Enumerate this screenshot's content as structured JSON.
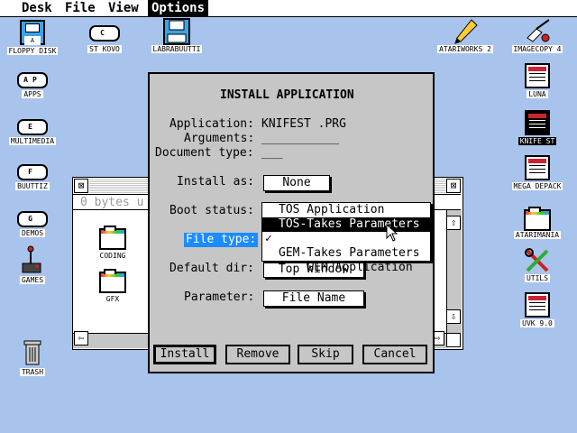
{
  "menubar": {
    "items": [
      {
        "label": "Desk"
      },
      {
        "label": "File"
      },
      {
        "label": "View"
      },
      {
        "label": "Options"
      }
    ]
  },
  "desktop": {
    "icons_left": [
      {
        "label": "FLOPPY DISK",
        "glyph": "A"
      },
      {
        "label": "APPS",
        "glyph": "AP"
      },
      {
        "label": "MULTIMEDIA",
        "glyph": "E"
      },
      {
        "label": "BUUTTIZ",
        "glyph": "F"
      },
      {
        "label": "DEMOS",
        "glyph": "G"
      },
      {
        "label": "GAMES"
      },
      {
        "label": "TRASH"
      }
    ],
    "icons_top": [
      {
        "label": "ST KOVO",
        "glyph": "C"
      },
      {
        "label": "LABRABUUTTI"
      }
    ],
    "icons_right": [
      {
        "label": "ATARIWORKS 2"
      },
      {
        "label": "IMAGECOPY 4"
      },
      {
        "label": "LUNA"
      },
      {
        "label": "KNIFE ST"
      },
      {
        "label": "MEGA DEPACK"
      },
      {
        "label": "ATARIMANIA"
      },
      {
        "label": "UTILS"
      },
      {
        "label": "UVK 9.0"
      }
    ]
  },
  "bgwindow": {
    "info": "0 bytes u",
    "items": [
      {
        "label": "CODING"
      },
      {
        "label": "GFX"
      }
    ],
    "close_glyph": "⊠",
    "full_glyph": "⊠",
    "up_glyph": "⇧",
    "down_glyph": "⇩",
    "left_glyph": "⇦",
    "right_glyph": "⇨"
  },
  "dialog": {
    "title": "INSTALL APPLICATION",
    "application_label": "Application:",
    "application_value": "KNIFEST .PRG",
    "arguments_label": "Arguments:",
    "arguments_value": "___________",
    "doctype_label": "Document type:",
    "doctype_value": "___",
    "install_as_label": "Install as:",
    "install_as_value": "None",
    "boot_status_label": "Boot status:",
    "file_type_label": "File type:",
    "default_dir_label": "Default dir:",
    "default_dir_value": "Top Window",
    "parameter_label": "Parameter:",
    "parameter_value": "File Name",
    "buttons": {
      "install": "Install",
      "remove": "Remove",
      "skip": "Skip",
      "cancel": "Cancel"
    }
  },
  "popup": {
    "options": [
      {
        "label": "TOS Application"
      },
      {
        "label": "TOS-Takes Parameters"
      },
      {
        "label": "GEM Application"
      },
      {
        "label": "GEM-Takes Parameters"
      }
    ],
    "check_glyph": "✓"
  },
  "colors": {
    "desktop": "#a9c4ec",
    "dialog": "#c6c6c6",
    "selection": "#1a8cff"
  }
}
